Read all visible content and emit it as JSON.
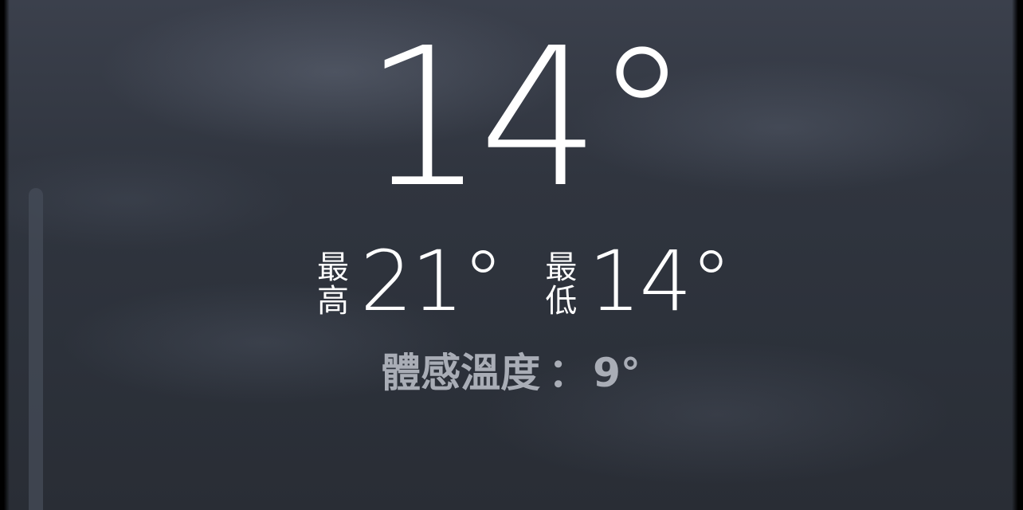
{
  "weather": {
    "current_temp": "14°",
    "high_label": [
      "最",
      "高"
    ],
    "high_value": "21°",
    "low_label": [
      "最",
      "低"
    ],
    "low_value": "14°",
    "feels_like_label": "體感溫度",
    "feels_like_separator": "：",
    "feels_like_value": "9°"
  },
  "colors": {
    "background": "#30353f",
    "primary_text": "#ffffff",
    "secondary_text": "#a9adb6"
  }
}
